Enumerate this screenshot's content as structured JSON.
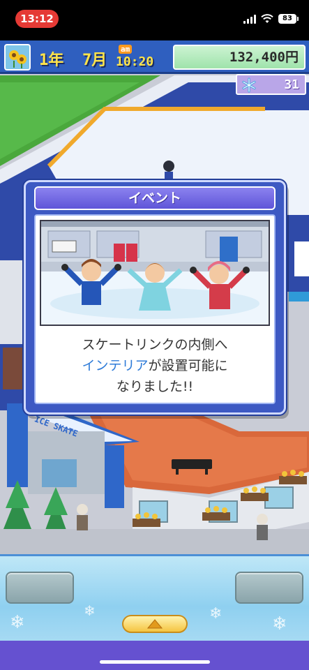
{
  "status_bar": {
    "time": "13:12",
    "battery": "83",
    "icons": [
      "cellular-signal-icon",
      "wifi-icon",
      "battery-icon"
    ]
  },
  "hud": {
    "icon": "sunflower-icon",
    "year": "1年",
    "month": "7月",
    "ampm": "am",
    "clock": "10:20",
    "money": "132,400円",
    "research_icon": "snowflake-icon",
    "research_points": "31"
  },
  "event": {
    "title": "イベント",
    "message_line1": "スケートリンクの内側へ",
    "message_highlight": "インテリア",
    "message_line2_rest": "が設置可能に",
    "message_line3": "なりました!!"
  },
  "world": {
    "sign_text": "ICE SKATE"
  },
  "bottom_menu": {
    "left_button_icon": "none",
    "right_button_icon": "none",
    "expand_icon": "triangle-up-icon"
  },
  "colors": {
    "hud_blue": "#2f5fbf",
    "money_green": "#9fe3ab",
    "dialog_blue": "#3d59c3",
    "highlight": "#2e7bd8",
    "time_pill": "#e53a35"
  }
}
